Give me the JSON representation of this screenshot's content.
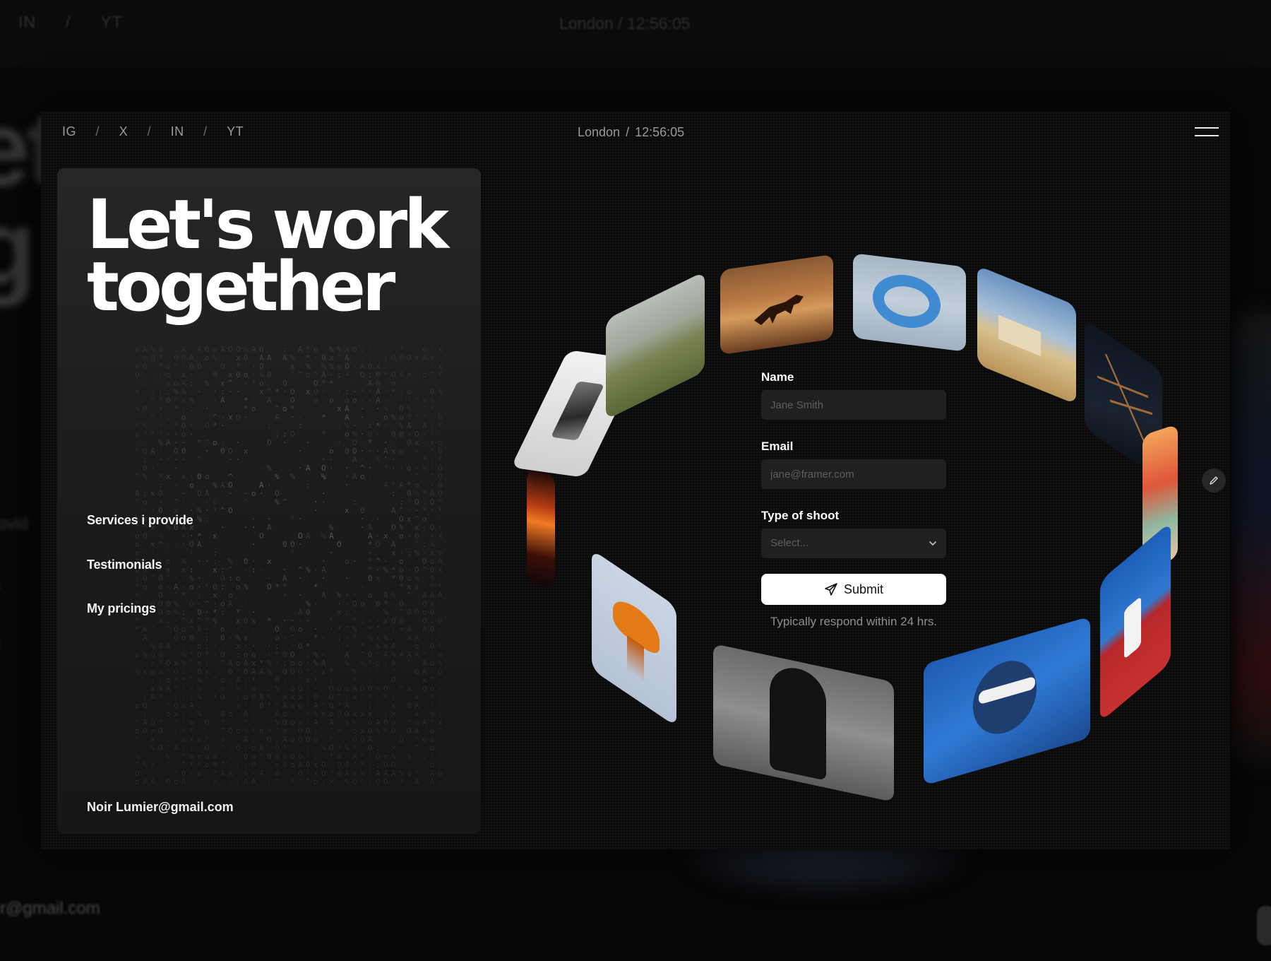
{
  "social_links": [
    {
      "label": "IG"
    },
    {
      "label": "X"
    },
    {
      "label": "IN"
    },
    {
      "label": "YT"
    }
  ],
  "social_separator": "/",
  "location": {
    "city": "London",
    "separator": "/",
    "time": "12:56:05"
  },
  "background": {
    "social": [
      "IN",
      "/",
      "YT"
    ],
    "clock": "London  /  12:56:05",
    "headline_fragments": [
      "et",
      "g"
    ],
    "nav_fragments": [
      "rovid",
      "s",
      "s"
    ],
    "email": "r@gmail.com"
  },
  "hero": {
    "line1": "Let's work",
    "line2": "together"
  },
  "nav": {
    "services": "Services i provide",
    "testimonials": "Testimonials",
    "pricings": "My pricings"
  },
  "contact_email": "Noir Lumier@gmail.com",
  "form": {
    "name_label": "Name",
    "name_placeholder": "Jane Smith",
    "email_label": "Email",
    "email_placeholder": "jane@framer.com",
    "shoot_label": "Type of shoot",
    "shoot_placeholder": "Select...",
    "submit_label": "Submit",
    "note": "Typically respond within 24 hrs."
  },
  "gallery": [
    "phone-photo",
    "hillside-photo",
    "horse-photo",
    "float-ring-photo",
    "desert-building-photo",
    "dragonfly-photo",
    "red-abstract-photo",
    "red-blue-figure-photo",
    "sunglasses-portrait-photo",
    "silhouette-photo",
    "jellyfish-photo",
    "fire-photo"
  ],
  "icons": {
    "menu": "menu-icon",
    "send": "send-icon",
    "chevron": "chevron-down-icon",
    "edit": "pencil-icon"
  },
  "colors": {
    "background": "#070707",
    "window": "#0b0b0b",
    "panel": "#1f1f1f",
    "text": "#ffffff",
    "muted": "#9a9a9a",
    "field": "#202020",
    "button": "#ffffff"
  }
}
